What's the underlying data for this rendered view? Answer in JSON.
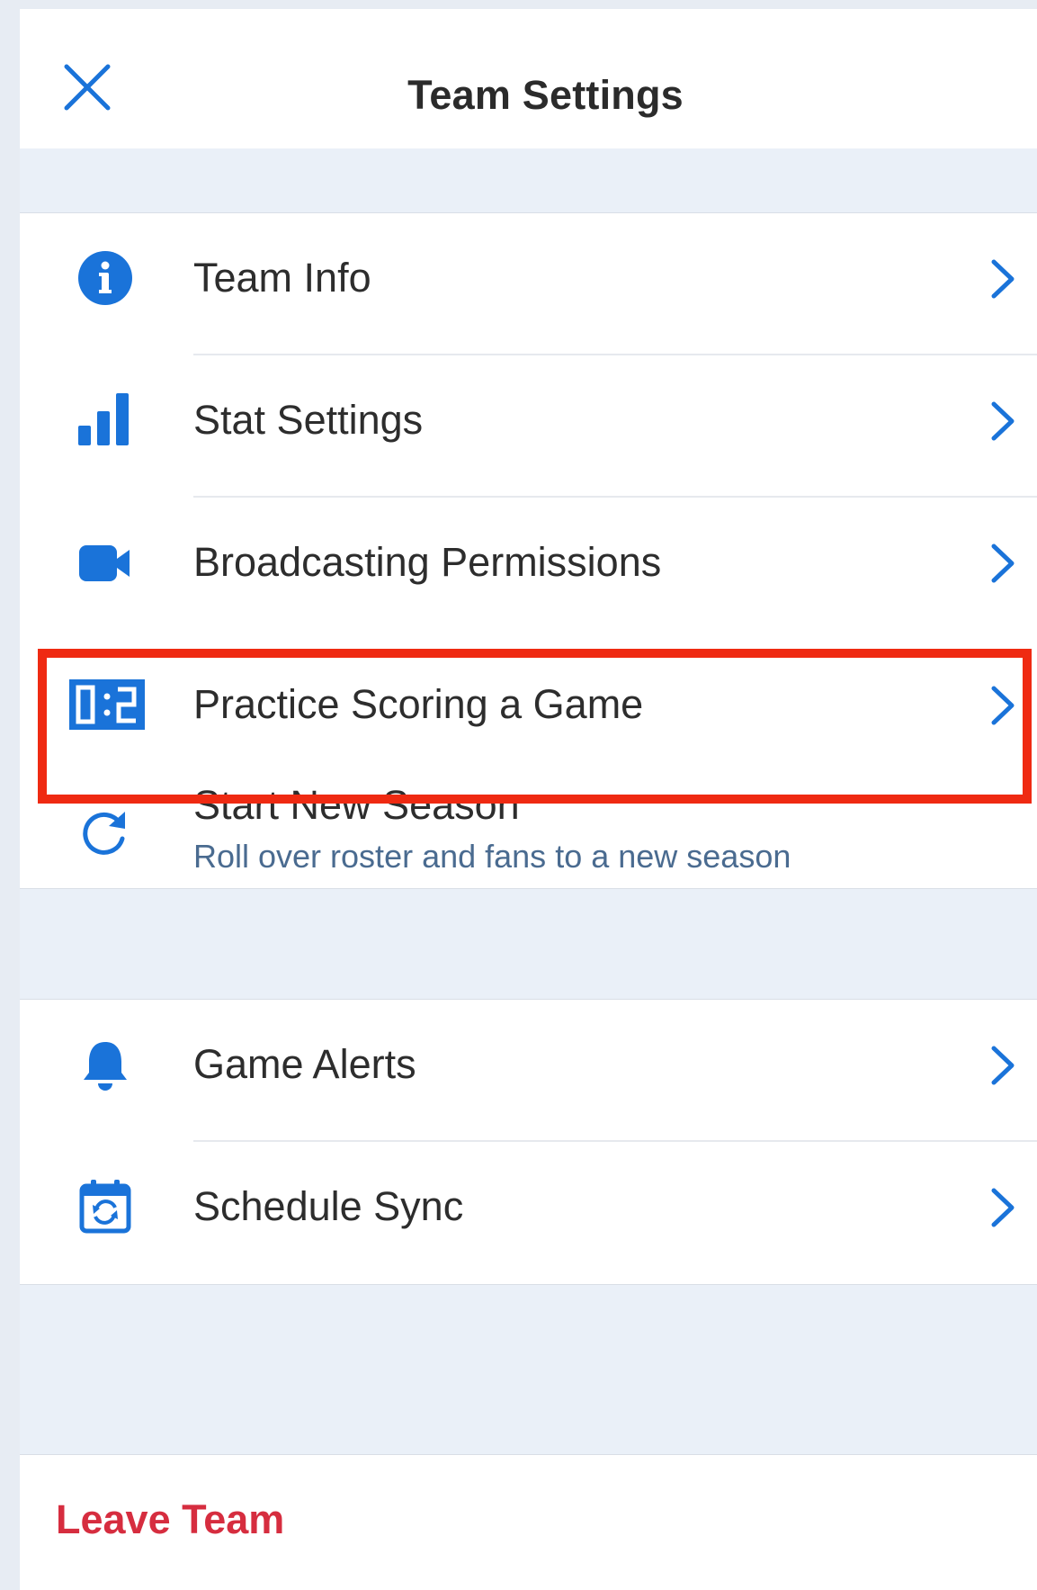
{
  "header": {
    "title": "Team Settings",
    "close_icon": "close-icon"
  },
  "group1": {
    "items": [
      {
        "label": "Team Info",
        "icon": "info-icon"
      },
      {
        "label": "Stat Settings",
        "icon": "bar-chart-icon"
      },
      {
        "label": "Broadcasting Permissions",
        "icon": "video-camera-icon"
      },
      {
        "label": "Practice Scoring a Game",
        "icon": "scoreboard-icon",
        "highlighted": true
      },
      {
        "label": "Start New Season",
        "sublabel": "Roll over roster and fans to a new season",
        "icon": "refresh-icon"
      }
    ]
  },
  "group2": {
    "items": [
      {
        "label": "Game Alerts",
        "icon": "bell-icon"
      },
      {
        "label": "Schedule Sync",
        "icon": "calendar-sync-icon"
      }
    ]
  },
  "footer": {
    "leave_label": "Leave Team"
  },
  "colors": {
    "accent": "#1a73d9",
    "danger": "#d62d3f",
    "highlight": "#ef2a12",
    "background": "#eaf0f8"
  }
}
